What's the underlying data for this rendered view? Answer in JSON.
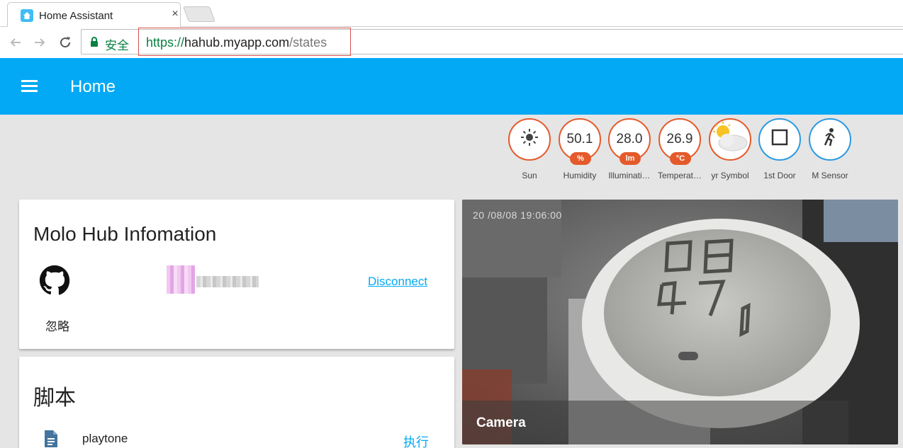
{
  "browser": {
    "tab_title": "Home Assistant",
    "tab_close": "×",
    "secure_label": "安全",
    "url_scheme": "https://",
    "url_host": "hahub.myapp.com",
    "url_path": "/states"
  },
  "header": {
    "title": "Home"
  },
  "badges": [
    {
      "label": "Sun",
      "value": "",
      "unit": "",
      "icon": "sun-icon"
    },
    {
      "label": "Humidity",
      "value": "50.1",
      "unit": "%",
      "icon": ""
    },
    {
      "label": "Illuminati…",
      "value": "28.0",
      "unit": "lm",
      "icon": ""
    },
    {
      "label": "Temperat…",
      "value": "26.9",
      "unit": "°C",
      "icon": ""
    },
    {
      "label": "yr Symbol",
      "value": "",
      "unit": "",
      "icon": "weather-partly-cloudy-icon"
    },
    {
      "label": "1st Door",
      "value": "",
      "unit": "",
      "icon": "door-icon"
    },
    {
      "label": "M Sensor",
      "value": "",
      "unit": "",
      "icon": "motion-sensor-icon"
    }
  ],
  "molo_card": {
    "title": "Molo Hub Infomation",
    "disconnect": "Disconnect",
    "ignore": "忽略"
  },
  "script_card": {
    "title": "脚本",
    "script_name": "playtone",
    "run_label": "执行"
  },
  "camera": {
    "label": "Camera",
    "timestamp": "20 /08/08 19:06:00"
  },
  "colors": {
    "header": "#03a9f4",
    "badge_border": "#e55a2b",
    "badge_border_blue": "#2b9ae0",
    "link": "#03a9f4"
  }
}
